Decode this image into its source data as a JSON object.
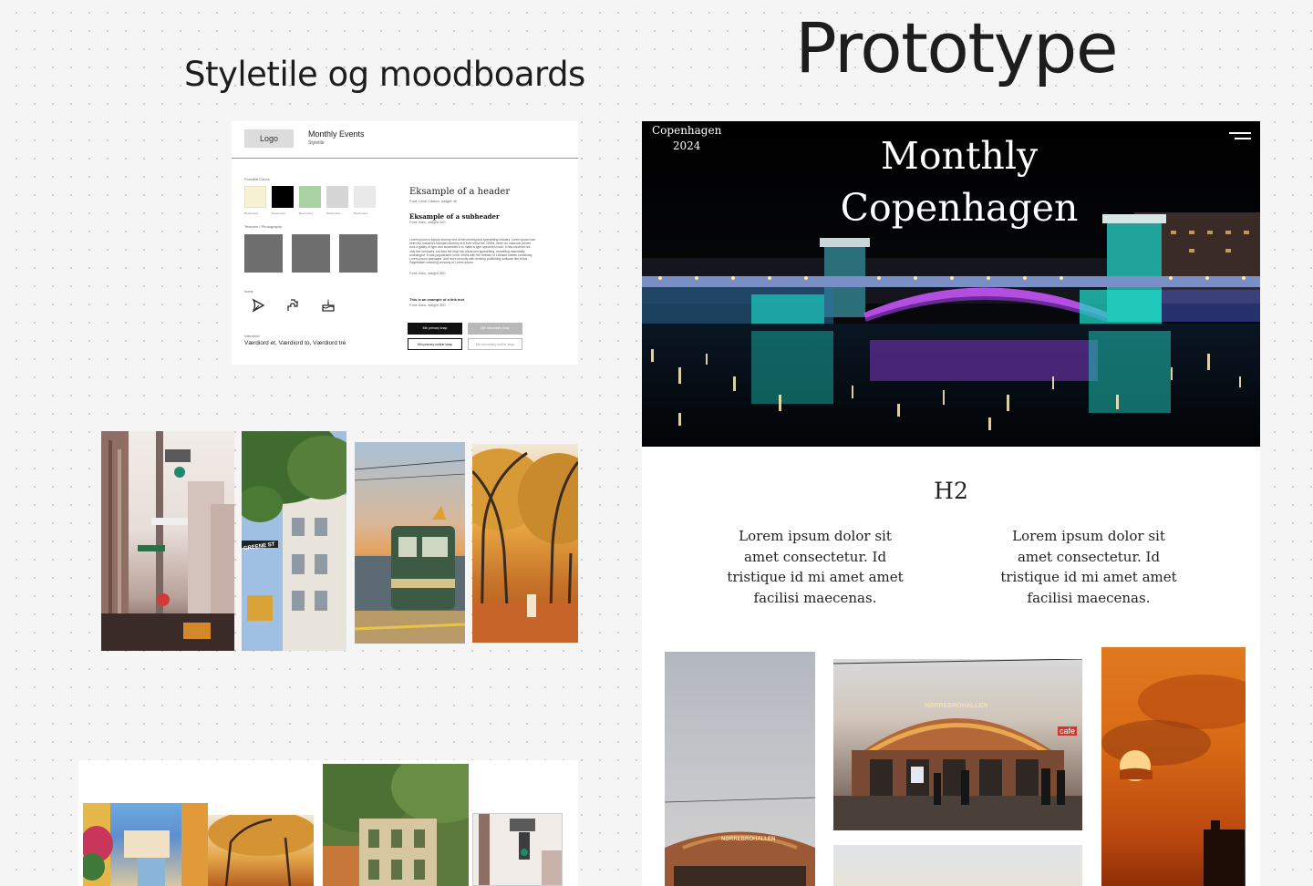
{
  "section_titles": {
    "styletile": "Styletile og moodboards",
    "prototype": "Prototype"
  },
  "styletile": {
    "logo": "Logo",
    "site_title": "Monthly Events",
    "site_subtitle": "Styletile",
    "colors_label": "Possible Colors",
    "colors": [
      "#f7f1d4",
      "#000000",
      "#a9d2a3",
      "#d6d6d6",
      "#e9e9e9"
    ],
    "color_names": [
      "Beskrivelse",
      "Beskrivelse",
      "Beskrivelse",
      "Beskrivelse",
      "Beskrivelse"
    ],
    "textures_label": "Textures / Photography",
    "icons_label": "Icons",
    "icons": [
      "play-icon",
      "puzzle-icon",
      "cake-icon"
    ],
    "values_label": "Værdiord",
    "values": "Værdiord et, Værdiord to, Værdiord tre",
    "header_example": "Eksample of a header",
    "header_meta": "Font: Libre Caslon, weight 46",
    "subheader_example": "Eksample of a subheader",
    "subheader_meta": "Font: Aleo, weight 100",
    "body_text": "Lorem ipsum is simply dummy text of the printing and typesetting industry. Lorem ipsum has been the industry's standard dummy text ever since the 1500s, when an unknown printer took a galley of type and scrambled it to make a type specimen book. It has survived not only five centuries, but also the leap into electronic typesetting, remaining essentially unchanged. It was popularised in the 1960s with the release of Letraset sheets containing Lorem Ipsum passages, and more recently with desktop publishing software like Aldus PageMaker including versions of Lorem Ipsum.",
    "body_meta": "Font: Aleo, weight 300",
    "small_example": "This is an example of a link text",
    "small_meta": "Font: Aleo, weight 300",
    "buttons": {
      "primary": "Min primary knap",
      "secondary": "Min secondary knap",
      "primary_outline": "Min primary outline knap",
      "secondary_outline": "Min secondary outline knap"
    }
  },
  "prototype": {
    "location": "Copenhagen",
    "year": "2024",
    "hero_title_line1": "Monthly",
    "hero_title_line2": "Copenhagen",
    "h2": "H2",
    "columns": [
      "Lorem ipsum dolor sit amet consectetur. Id tristique id mi amet amet facilisi maecenas.",
      "Lorem ipsum dolor sit amet consectetur. Id tristique id mi amet amet facilisi maecenas."
    ],
    "sign_text": "NØRREBROHALLEN",
    "cafe_sign": "cafe"
  },
  "moodboard": {
    "street_sign": "GREENE ST"
  }
}
